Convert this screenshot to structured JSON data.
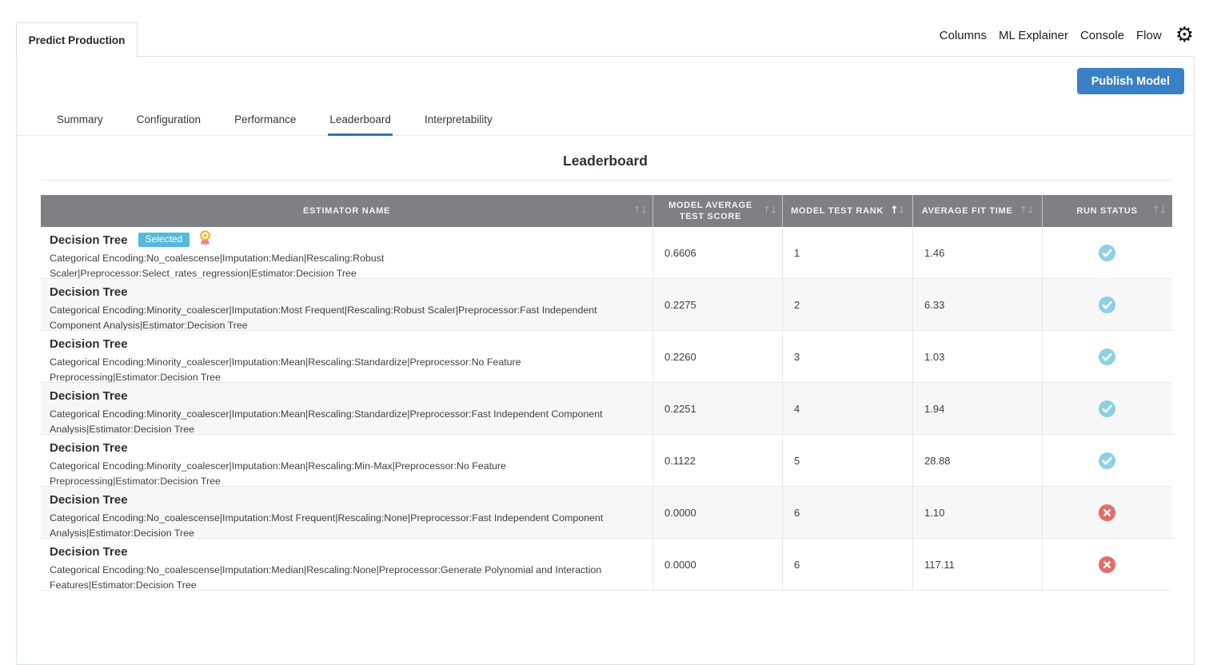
{
  "window": {
    "tab_title": "Predict Production"
  },
  "top_nav": {
    "items": [
      {
        "label": "Columns"
      },
      {
        "label": "ML Explainer"
      },
      {
        "label": "Console"
      },
      {
        "label": "Flow"
      }
    ],
    "gear_icon": "⚙"
  },
  "actions": {
    "publish_label": "Publish Model"
  },
  "tabs": {
    "items": [
      {
        "label": "Summary",
        "active": false
      },
      {
        "label": "Configuration",
        "active": false
      },
      {
        "label": "Performance",
        "active": false
      },
      {
        "label": "Leaderboard",
        "active": true
      },
      {
        "label": "Interpretability",
        "active": false
      }
    ]
  },
  "page": {
    "title": "Leaderboard"
  },
  "table": {
    "sorted_by": "MODEL TEST RANK",
    "sort_direction": "ascending",
    "sort_icons": {
      "up": "↑",
      "down": "↓"
    },
    "columns": [
      {
        "label": "ESTIMATOR NAME"
      },
      {
        "label": "MODEL AVERAGE TEST SCORE"
      },
      {
        "label": "MODEL TEST RANK"
      },
      {
        "label": "AVERAGE FIT TIME"
      },
      {
        "label": "RUN STATUS"
      }
    ],
    "rows": [
      {
        "name": "Decision Tree",
        "badge": "Selected",
        "medal": true,
        "description": "Categorical Encoding:No_coalescense|Imputation:Median|Rescaling:Robust Scaler|Preprocessor:Select_rates_regression|Estimator:Decision Tree",
        "score": "0.6606",
        "rank": "1",
        "fit_time": "1.46",
        "status": "success"
      },
      {
        "name": "Decision Tree",
        "description": "Categorical Encoding:Minority_coalescer|Imputation:Most Frequent|Rescaling:Robust Scaler|Preprocessor:Fast Independent Component Analysis|Estimator:Decision Tree",
        "score": "0.2275",
        "rank": "2",
        "fit_time": "6.33",
        "status": "success"
      },
      {
        "name": "Decision Tree",
        "description": "Categorical Encoding:Minority_coalescer|Imputation:Mean|Rescaling:Standardize|Preprocessor:No Feature Preprocessing|Estimator:Decision Tree",
        "score": "0.2260",
        "rank": "3",
        "fit_time": "1.03",
        "status": "success"
      },
      {
        "name": "Decision Tree",
        "description": "Categorical Encoding:Minority_coalescer|Imputation:Mean|Rescaling:Standardize|Preprocessor:Fast Independent Component Analysis|Estimator:Decision Tree",
        "score": "0.2251",
        "rank": "4",
        "fit_time": "1.94",
        "status": "success"
      },
      {
        "name": "Decision Tree",
        "description": "Categorical Encoding:Minority_coalescer|Imputation:Mean|Rescaling:Min-Max|Preprocessor:No Feature Preprocessing|Estimator:Decision Tree",
        "score": "0.1122",
        "rank": "5",
        "fit_time": "28.88",
        "status": "success"
      },
      {
        "name": "Decision Tree",
        "description": "Categorical Encoding:No_coalescense|Imputation:Most Frequent|Rescaling:None|Preprocessor:Fast Independent Component Analysis|Estimator:Decision Tree",
        "score": "0.0000",
        "rank": "6",
        "fit_time": "1.10",
        "status": "failed"
      },
      {
        "name": "Decision Tree",
        "description": "Categorical Encoding:No_coalescense|Imputation:Median|Rescaling:None|Preprocessor:Generate Polynomial and Interaction Features|Estimator:Decision Tree",
        "score": "0.0000",
        "rank": "6",
        "fit_time": "117.11",
        "status": "failed"
      }
    ]
  },
  "colors": {
    "header_bg": "#7f8084",
    "accent_blue": "#3a80c6",
    "tab_underline": "#2a78b8",
    "selected_badge": "#54b9da",
    "status_success": "#8ed1e1",
    "status_failed": "#e26c6c",
    "row_stripe": "#f7f7f7"
  }
}
